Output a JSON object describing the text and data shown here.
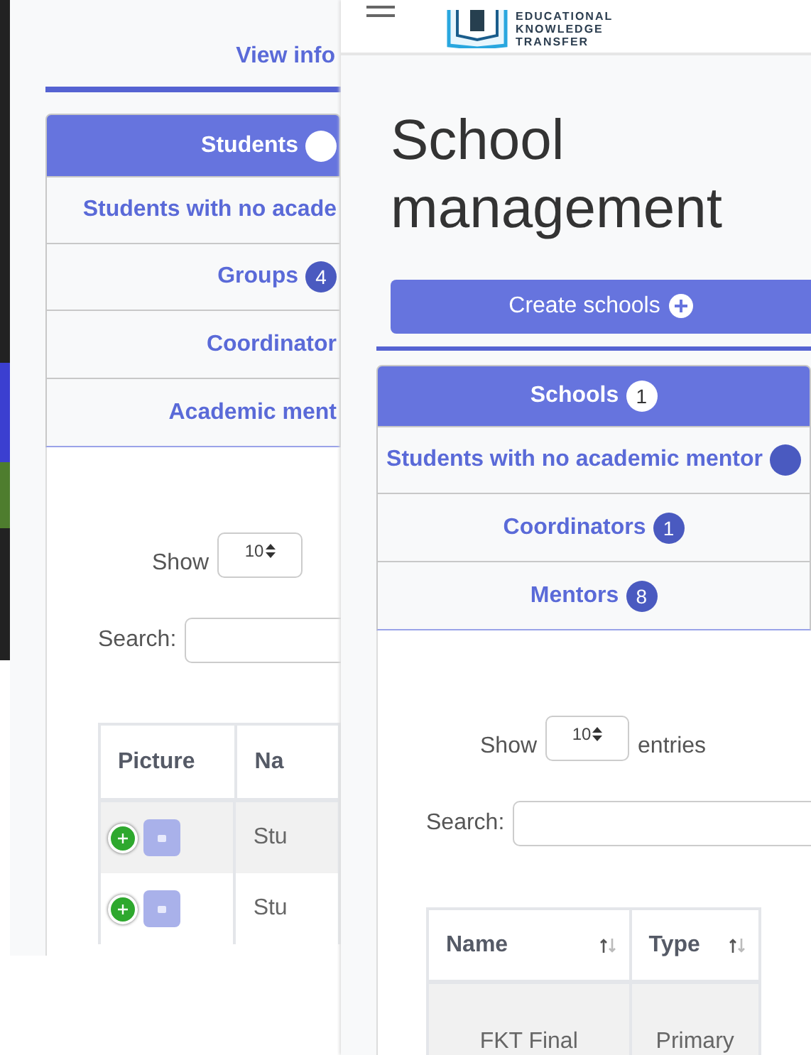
{
  "left_screen": {
    "view_info": "View info",
    "tabs": [
      {
        "label": "Students",
        "has_badge": true,
        "selected": true
      },
      {
        "label": "Students with no acade",
        "selected": false
      },
      {
        "label": "Groups",
        "badge": "4",
        "selected": false
      },
      {
        "label": "Coordinator",
        "selected": false
      },
      {
        "label": "Academic ment",
        "selected": false
      }
    ],
    "length_control": {
      "label": "Show",
      "value": "10"
    },
    "search": {
      "label": "Search:"
    },
    "table": {
      "columns": [
        {
          "label": "Picture"
        },
        {
          "label": "Na"
        }
      ],
      "rows": [
        {
          "cells": [
            "Stu"
          ]
        },
        {
          "cells": [
            "Stu"
          ]
        }
      ]
    }
  },
  "right_screen": {
    "logo_lines": [
      "EDUCATIONAL",
      "KNOWLEDGE",
      "TRANSFER"
    ],
    "title": "School management",
    "create_button": "Create schools",
    "tabs": [
      {
        "label": "Schools",
        "badge": "1",
        "selected": true
      },
      {
        "label": "Students with no academic mentor",
        "has_badge": true,
        "selected": false
      },
      {
        "label": "Coordinators",
        "badge": "1",
        "selected": false
      },
      {
        "label": "Mentors",
        "badge": "8",
        "selected": false
      }
    ],
    "length_control": {
      "label": "Show",
      "value": "10",
      "suffix": "entries"
    },
    "search": {
      "label": "Search:"
    },
    "table": {
      "columns": [
        {
          "label": "Name",
          "sortable": true
        },
        {
          "label": "Type",
          "sortable": true
        }
      ],
      "rows": [
        {
          "cells": [
            "FKT Final",
            "Primary"
          ]
        }
      ]
    }
  }
}
